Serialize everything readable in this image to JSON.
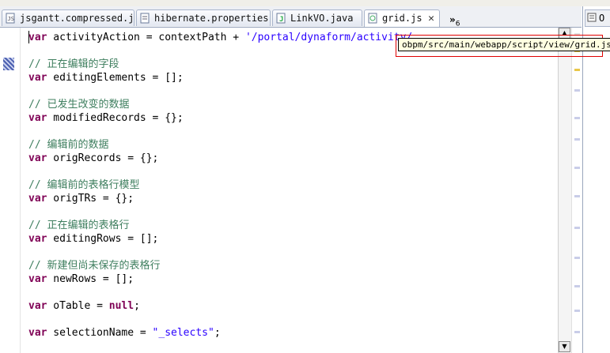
{
  "tabs": [
    {
      "label": "jsgantt.compressed.j",
      "icon": "js-file-icon"
    },
    {
      "label": "hibernate.properties",
      "icon": "properties-file-icon"
    },
    {
      "label": "LinkVO.java",
      "icon": "java-file-icon"
    },
    {
      "label": "grid.js",
      "icon": "js-file-icon",
      "active": true,
      "close": "✕"
    }
  ],
  "overflow_label": "»",
  "overflow_count": "6",
  "right_tab_label": "O",
  "tooltip_text": "obpm/src/main/webapp/script/view/grid.js",
  "code": {
    "l1_a": "var",
    "l1_b": " activityAction = contextPath + ",
    "l1_c": "'/portal/dynaform/activity/",
    "l2": "// 正在编辑的字段",
    "l3_a": "var",
    "l3_b": " editingElements = [];",
    "l4": "// 已发生改变的数据",
    "l5_a": "var",
    "l5_b": " modifiedRecords = {};",
    "l6": "// 编辑前的数据",
    "l7_a": "var",
    "l7_b": " origRecords = {};",
    "l8": "// 编辑前的表格行模型",
    "l9_a": "var",
    "l9_b": " origTRs = {};",
    "l10": "// 正在编辑的表格行",
    "l11_a": "var",
    "l11_b": " editingRows = [];",
    "l12": "// 新建但尚未保存的表格行",
    "l13_a": "var",
    "l13_b": " newRows = [];",
    "l14_a": "var",
    "l14_b": " oTable = ",
    "l14_c": "null",
    "l14_d": ";",
    "l15_a": "var",
    "l15_b": " selectionName = ",
    "l15_c": "\"_selects\"",
    "l15_d": ";"
  },
  "colors": {
    "keyword": "#7f0055",
    "comment": "#3f7f5f",
    "string": "#2a00ff",
    "highlight_box": "#e00000"
  }
}
